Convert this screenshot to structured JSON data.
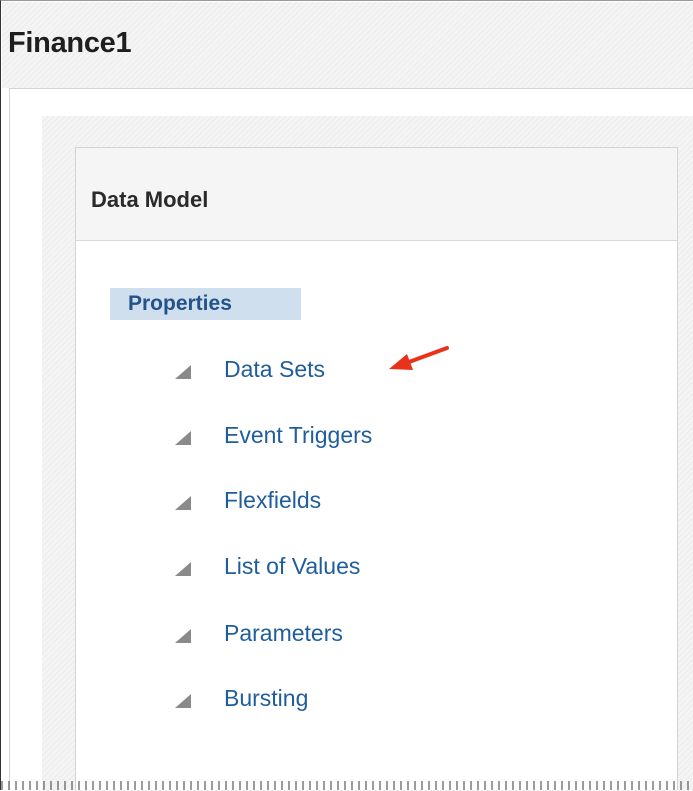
{
  "window": {
    "title": "Finance1"
  },
  "panel": {
    "title": "Data Model",
    "section_label": "Properties",
    "items": [
      {
        "label": "Data Sets"
      },
      {
        "label": "Event Triggers"
      },
      {
        "label": "Flexfields"
      },
      {
        "label": "List of Values"
      },
      {
        "label": "Parameters"
      },
      {
        "label": "Bursting"
      }
    ]
  },
  "icons": {
    "item_icon": "expand-triangle-icon",
    "annotation": "red-arrow-icon"
  },
  "colors": {
    "link": "#1f5d9c",
    "section_label_text": "#24528a",
    "section_label_bg": "#cfdfee",
    "annotation_arrow": "#e8321a"
  }
}
